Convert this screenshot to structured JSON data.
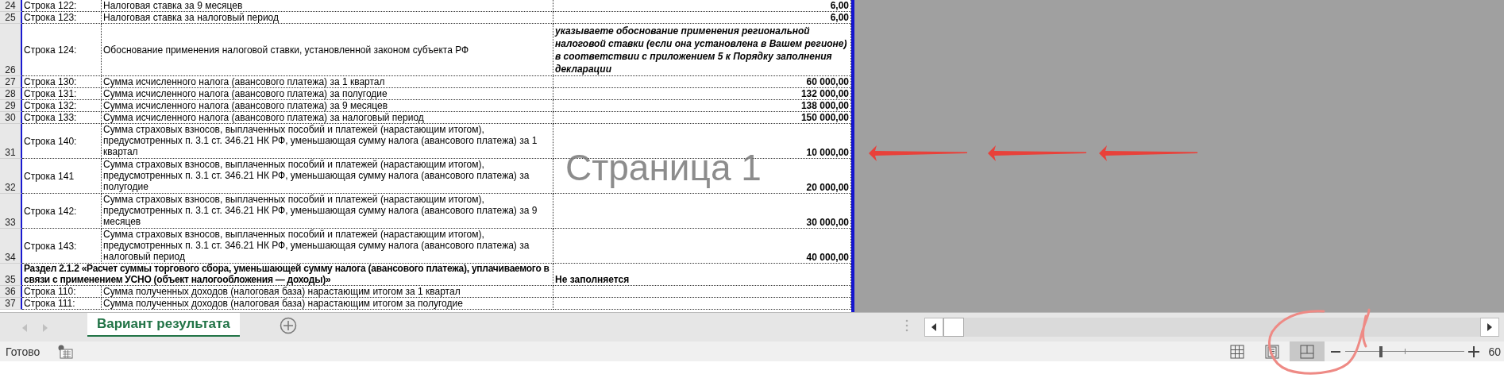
{
  "sheet": {
    "rows": [
      {
        "kind": "line",
        "number": "24",
        "label": "Строка 122:",
        "description": "Налоговая ставка за 9 месяцев",
        "value": "6,00"
      },
      {
        "kind": "line",
        "number": "25",
        "label": "Строка 123:",
        "description": "Налоговая ставка за налоговый период",
        "value": "6,00"
      },
      {
        "kind": "note",
        "number": "26",
        "label": "Строка 124:",
        "description": "Обоснование применения налоговой ставки, установленной законом субъекта РФ",
        "value": "указываете обоснование применения региональной налоговой ставки (если она установлена в Вашем регионе) в соответствии с приложением 5 к Порядку заполнения декларации"
      },
      {
        "kind": "line",
        "number": "27",
        "label": "Строка 130:",
        "description": "Сумма исчисленного налога (авансового платежа) за 1 квартал",
        "value": "60 000,00"
      },
      {
        "kind": "line",
        "number": "28",
        "label": "Строка 131:",
        "description": "Сумма исчисленного налога (авансового платежа) за полугодие",
        "value": "132 000,00"
      },
      {
        "kind": "line",
        "number": "29",
        "label": "Строка 132:",
        "description": "Сумма исчисленного налога (авансового платежа) за 9 месяцев",
        "value": "138 000,00"
      },
      {
        "kind": "line",
        "number": "30",
        "label": "Строка 133:",
        "description": "Сумма исчисленного налога (авансового платежа) за налоговый период",
        "value": "150 000,00"
      },
      {
        "kind": "tall",
        "number": "31",
        "label": "Строка 140:",
        "description": "Сумма страховых взносов, выплаченных пособий и платежей (нарастающим итогом), предусмотренных п. 3.1 ст. 346.21 НК РФ, уменьшающая сумму налога (авансового платежа) за 1 квартал",
        "value": "10 000,00"
      },
      {
        "kind": "tall",
        "number": "32",
        "label": "Строка 141",
        "description": "Сумма страховых взносов, выплаченных пособий и платежей (нарастающим итогом), предусмотренных п. 3.1 ст. 346.21 НК РФ, уменьшающая сумму налога (авансового платежа) за полугодие",
        "value": "20 000,00"
      },
      {
        "kind": "tall",
        "number": "33",
        "label": "Строка 142:",
        "description": "Сумма страховых взносов, выплаченных пособий и платежей (нарастающим итогом), предусмотренных п. 3.1 ст. 346.21 НК РФ, уменьшающая сумму налога (авансового платежа) за 9 месяцев",
        "value": "30 000,00"
      },
      {
        "kind": "tall",
        "number": "34",
        "label": "Строка 143:",
        "description": "Сумма страховых взносов, выплаченных пособий и платежей (нарастающим итогом), предусмотренных п. 3.1 ст. 346.21 НК РФ, уменьшающая сумму налога (авансового платежа) за налоговый период",
        "value": "40 000,00"
      },
      {
        "kind": "section",
        "number": "35",
        "label": "Раздел 2.1.2 «Расчет суммы торгового сбора, уменьшающей сумму налога (авансового платежа), уплачиваемого в связи с применением УСНО (объект налогообложения — доходы)»",
        "value": "Не заполняется"
      },
      {
        "kind": "line",
        "number": "36",
        "label": "Строка 110:",
        "description": "Сумма полученных доходов (налоговая база) нарастающим итогом за 1 квартал"
      },
      {
        "kind": "line",
        "number": "37",
        "label": "Строка 111:",
        "description": "Сумма полученных доходов (налоговая база) нарастающим итогом за полугодие"
      }
    ],
    "page_label": "Страница 1"
  },
  "sheet_tabs": [
    {
      "label": "Вариант результата",
      "selected": true
    }
  ],
  "status_bar": {
    "status": "Готово",
    "views": [
      {
        "kind": "normal",
        "selected": false
      },
      {
        "kind": "page_layout",
        "selected": false
      },
      {
        "kind": "page_break",
        "selected": true
      }
    ],
    "zoom": {
      "level": 0.3,
      "reading": "60"
    }
  }
}
